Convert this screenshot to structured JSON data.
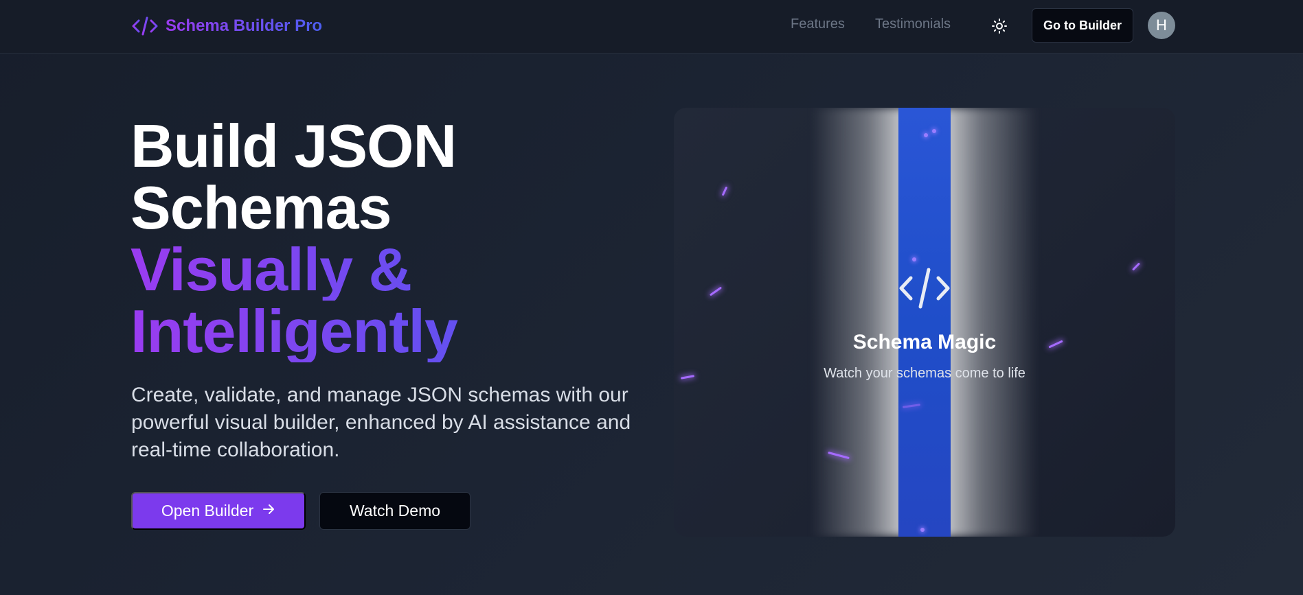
{
  "brand": {
    "name": "Schema Builder Pro",
    "icon": "code-icon",
    "gradient": [
      "#9a3cf0",
      "#4c5ef0"
    ]
  },
  "nav": {
    "links": [
      {
        "label": "Features"
      },
      {
        "label": "Testimonials"
      }
    ],
    "theme_toggle_icon": "sun-icon",
    "cta_label": "Go to Builder",
    "avatar_initial": "H"
  },
  "hero": {
    "title_lines": [
      "Build JSON",
      "Schemas"
    ],
    "highlight_lines": [
      "Visually &",
      "Intelligently"
    ],
    "description": "Create, validate, and manage JSON schemas with our powerful visual builder, enhanced by AI assistance and real-time collaboration.",
    "primary_button": {
      "label": "Open Builder",
      "icon": "arrow-right-icon",
      "color": "#7c3aed"
    },
    "secondary_button": {
      "label": "Watch Demo"
    }
  },
  "showcase": {
    "icon": "code-icon",
    "title": "Schema Magic",
    "subtitle": "Watch your schemas come to life",
    "beam_color": "#2a56d6"
  }
}
